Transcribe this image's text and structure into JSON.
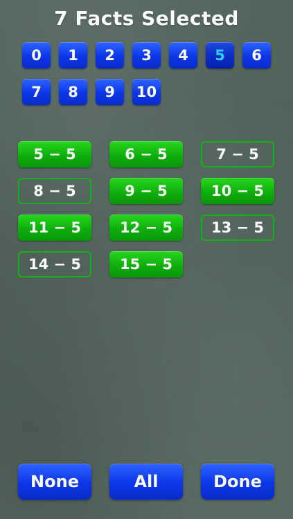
{
  "header": {
    "title": "7 Facts Selected"
  },
  "numbers": {
    "items": [
      "0",
      "1",
      "2",
      "3",
      "4",
      "5",
      "6",
      "7",
      "8",
      "9",
      "10"
    ],
    "selected": "5",
    "selected_color": "#33ccff"
  },
  "facts": {
    "items": [
      {
        "label": "5 − 5",
        "selected": true
      },
      {
        "label": "6 − 5",
        "selected": true
      },
      {
        "label": "7 − 5",
        "selected": false
      },
      {
        "label": "8 − 5",
        "selected": false
      },
      {
        "label": "9 − 5",
        "selected": true
      },
      {
        "label": "10 − 5",
        "selected": true
      },
      {
        "label": "11 − 5",
        "selected": true
      },
      {
        "label": "12 − 5",
        "selected": true
      },
      {
        "label": "13 − 5",
        "selected": false
      },
      {
        "label": "14 − 5",
        "selected": false
      },
      {
        "label": "15 − 5",
        "selected": true
      }
    ]
  },
  "actions": {
    "none_label": "None",
    "all_label": "All",
    "done_label": "Done"
  },
  "colors": {
    "button_blue": "#0c36e8",
    "fact_green": "#0fae0c",
    "chalkboard": "#4f6159"
  }
}
